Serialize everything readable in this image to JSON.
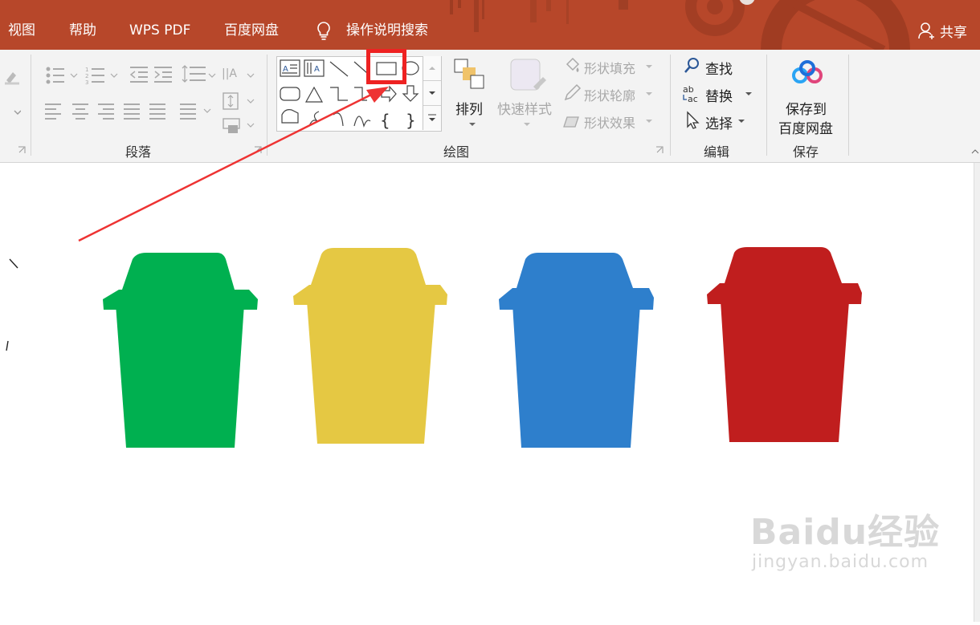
{
  "tabs": {
    "view": "视图",
    "help": "帮助",
    "wps_pdf": "WPS PDF",
    "baidu_disk": "百度网盘",
    "tell_me": "操作说明搜索",
    "share": "共享"
  },
  "ribbon": {
    "paragraph_group": "段落",
    "drawing_group": "绘图",
    "editing_group": "编辑",
    "save_group": "保存",
    "arrange": "排列",
    "quick_styles": "快速样式",
    "shape_fill": "形状填充",
    "shape_outline": "形状轮廓",
    "shape_effects": "形状效果",
    "find": "查找",
    "replace": "替换",
    "select": "选择",
    "save_to_line1": "保存到",
    "save_to_line2": "百度网盘",
    "replace_icon_text": "ab",
    "replace_icon_text2": "ac"
  },
  "shapes_gallery": {
    "brace_left": "{",
    "brace_right": "}"
  },
  "bins": [
    {
      "color": "#00b050"
    },
    {
      "color": "#e5c843"
    },
    {
      "color": "#2e7fcc"
    },
    {
      "color": "#c01e1e"
    }
  ],
  "annotation": {
    "highlight_color": "#ee2222"
  },
  "watermark": {
    "logo": "Baidu经验",
    "url": "jingyan.baidu.com"
  },
  "colors": {
    "title_bar": "#b7472a",
    "ribbon_bg": "#f3f3f3"
  }
}
